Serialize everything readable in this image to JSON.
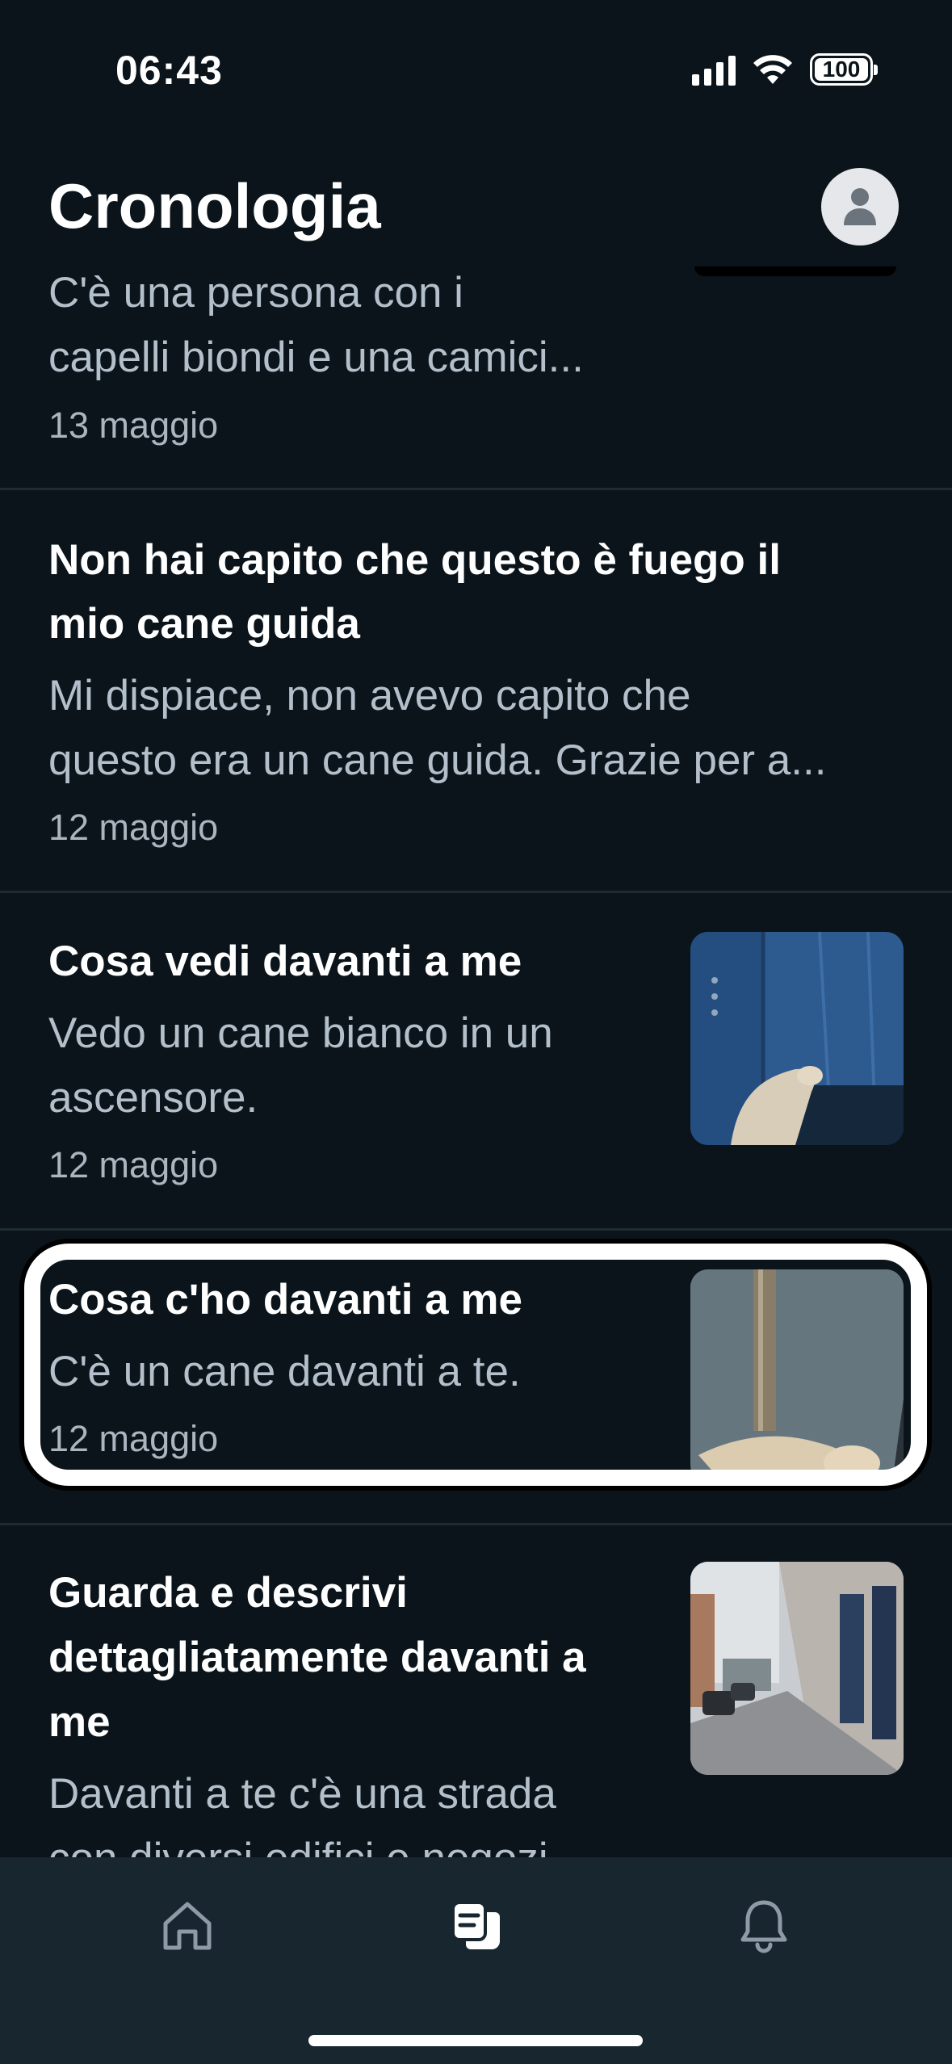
{
  "status": {
    "time": "06:43",
    "battery": "100"
  },
  "header": {
    "title": "Cronologia"
  },
  "items": [
    {
      "title": "",
      "desc1": "C'è una persona con i",
      "desc2": "capelli biondi e una camici...",
      "date": "13 maggio"
    },
    {
      "title1": "Non hai capito che questo è fuego il",
      "title2": "mio cane guida",
      "desc1": "Mi dispiace, non avevo capito che",
      "desc2": "questo era un cane guida. Grazie per a...",
      "date": "12 maggio"
    },
    {
      "title1": "Cosa vedi davanti a me",
      "desc1": "Vedo un cane bianco in un",
      "desc2": "ascensore.",
      "date": "12 maggio"
    },
    {
      "title1": "Cosa c'ho davanti a me",
      "desc1": "C'è un cane davanti a te.",
      "date": "12 maggio"
    },
    {
      "title1": "Guarda e descrivi",
      "title2": "dettagliatamente davanti a",
      "title3": "me",
      "desc1": "Davanti a te c'è una strada",
      "desc2": "con diversi edifici e negozi..."
    }
  ],
  "tabs": [
    {
      "icon": "home-icon"
    },
    {
      "icon": "history-icon"
    },
    {
      "icon": "bell-icon"
    }
  ],
  "colors": {
    "background": "#0a141a",
    "tabbar": "#18262f",
    "muted_text": "#b3bfca"
  }
}
